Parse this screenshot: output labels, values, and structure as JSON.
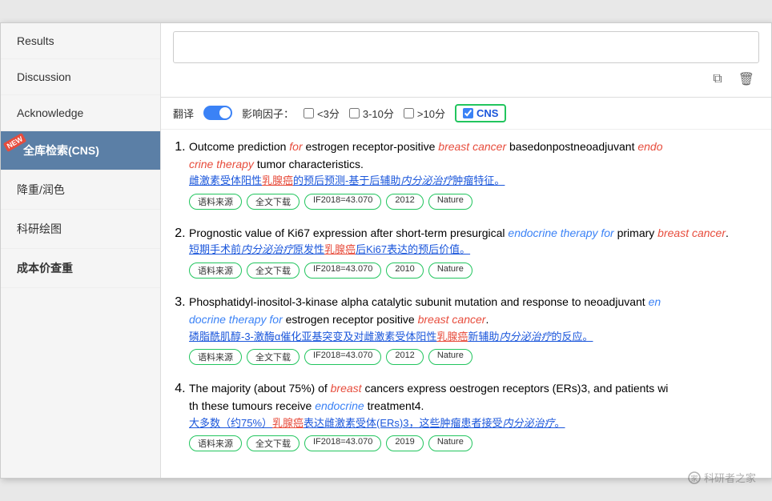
{
  "sidebar": {
    "items": [
      {
        "id": "results",
        "label": "Results",
        "active": false
      },
      {
        "id": "discussion",
        "label": "Discussion",
        "active": false
      },
      {
        "id": "acknowledge",
        "label": "Acknowledge",
        "active": false
      },
      {
        "id": "cns-search",
        "label": "全库检索(CNS)",
        "active": true,
        "new": true
      },
      {
        "id": "recolor",
        "label": "降重/润色",
        "active": false
      },
      {
        "id": "chart",
        "label": "科研绘图",
        "active": false
      },
      {
        "id": "cost",
        "label": "成本价查重",
        "active": false,
        "bold": true
      }
    ]
  },
  "filter": {
    "translate_label": "翻译",
    "impact_label": "影响因子：",
    "opt1": "<3分",
    "opt2": "3-10分",
    "opt3": ">10分",
    "cns_label": "CNS"
  },
  "results": [
    {
      "num": 1,
      "title_plain": "Outcome prediction ",
      "title_for": "for",
      "title_mid": " estrogen receptor-positive ",
      "title_em": "breast cancer",
      "title_rest": " basedonpostneoadjuvant ",
      "title_endo": "endo",
      "title_crine": "crine therapy",
      "title_last": " tumor characteristics.",
      "translation": "雌激素受体阳性乳腺癌的预后预测-基于后辅助内分泌治疗肿瘤特征。",
      "tags": [
        "语料来源",
        "全文下载",
        "IF2018=43.070",
        "2012",
        "Nature"
      ]
    },
    {
      "num": 2,
      "title_plain": "Prognostic value of Ki67 expression after short-term presurgical ",
      "title_em": "endocrine therapy for",
      "title_rest": " primary ",
      "title_em2": "breast cancer",
      "title_last": ".",
      "translation": "短期手术前内分泌治疗原发性乳腺癌后Ki67表达的预后价值。",
      "tags": [
        "语料来源",
        "全文下载",
        "IF2018=43.070",
        "2010",
        "Nature"
      ]
    },
    {
      "num": 3,
      "title_plain": "Phosphatidyl-inositol-3-kinase alpha catalytic subunit mutation and response to neoadjuvant ",
      "title_em": "en",
      "title_em2": "docrine therapy for",
      "title_rest": " estrogen receptor positive ",
      "title_em3": "breast cancer",
      "title_last": ".",
      "translation": "磷脂酰肌醇-3-激酶α催化亚基突变及对雌激素受体阳性乳腺癌新辅助内分泌治疗的反应。",
      "tags": [
        "语料来源",
        "全文下载",
        "IF2018=43.070",
        "2012",
        "Nature"
      ]
    },
    {
      "num": 4,
      "title_plain": "The majority (about 75%) of ",
      "title_em": "breast",
      "title_mid": " cancers express oestrogen receptors (ERs)3, and patients with these tumours receive ",
      "title_endo": "endocrine",
      "title_last": " treatment4.",
      "translation": "大多数（约75%）乳腺癌表达雌激素受体(ERs)3，这些肿瘤患者接受内分泌治疗。",
      "tags": [
        "语料来源",
        "全文下载",
        "IF2018=43.070",
        "2019",
        "Nature"
      ]
    }
  ],
  "watermark": "科研者之家"
}
